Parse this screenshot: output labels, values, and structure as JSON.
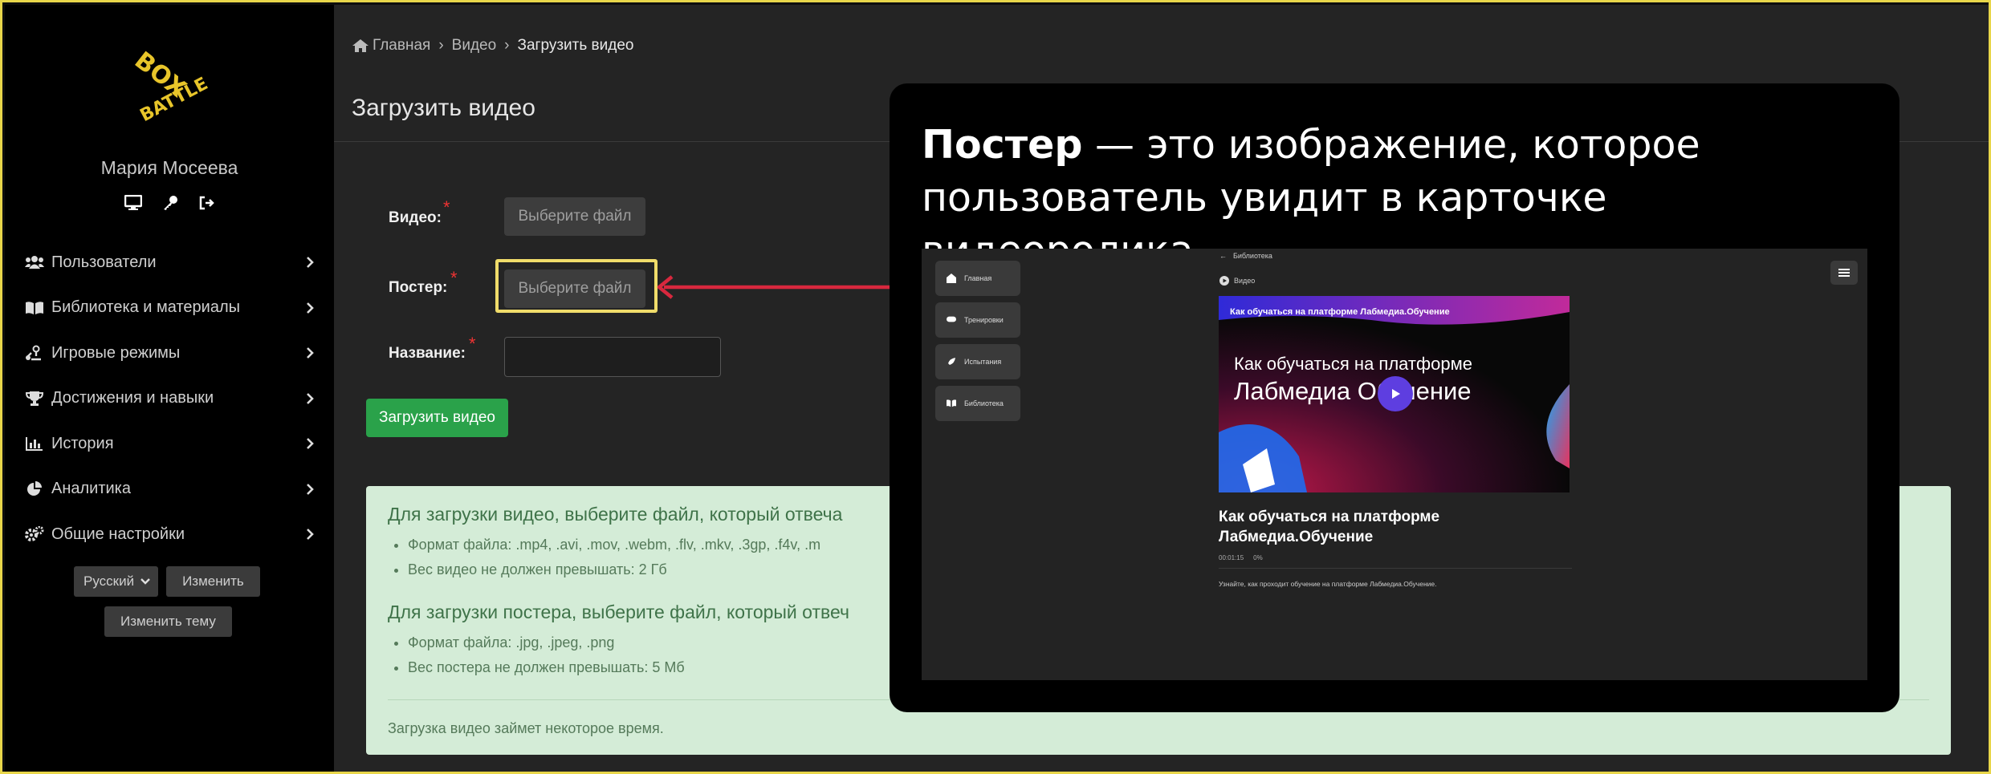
{
  "sidebar": {
    "logo_text": "BOX BATTLE",
    "user_name": "Мария Мосеева",
    "menu": [
      {
        "label": "Пользователи",
        "icon": "users-icon"
      },
      {
        "label": "Библиотека и материалы",
        "icon": "book-icon"
      },
      {
        "label": "Игровые режимы",
        "icon": "game-mode-icon"
      },
      {
        "label": "Достижения и навыки",
        "icon": "trophy-icon"
      },
      {
        "label": "История",
        "icon": "bar-chart-icon"
      },
      {
        "label": "Аналитика",
        "icon": "pie-chart-icon"
      },
      {
        "label": "Общие настройки",
        "icon": "gears-icon"
      }
    ],
    "language": "Русский",
    "change_label": "Изменить",
    "change_theme_label": "Изменить тему"
  },
  "breadcrumb": {
    "home": "Главная",
    "video": "Видео",
    "current": "Загрузить видео"
  },
  "page_title": "Загрузить видео",
  "form": {
    "video_label": "Видео:",
    "poster_label": "Постер:",
    "name_label": "Название:",
    "file_button": "Выберите файл",
    "name_value": "",
    "submit_label": "Загрузить видео"
  },
  "info": {
    "video_heading": "Для загрузки видео, выберите файл, который отвеча",
    "video_items": [
      "Формат файла: .mp4, .avi, .mov, .webm, .flv, .mkv, .3gp, .f4v, .m",
      "Вес видео не должен превышать: 2 Гб"
    ],
    "poster_heading": "Для загрузки постера, выберите файл, который отвеч",
    "poster_items": [
      "Формат файла: .jpg, .jpeg, .png",
      "Вес постера не должен превышать: 5 Мб"
    ],
    "note": "Загрузка видео займет некоторое время."
  },
  "callout": {
    "bold": "Постер",
    "rest": " — это изображение, которое пользователь увидит в карточке видеоролика."
  },
  "preview": {
    "nav": [
      "Главная",
      "Тренировки",
      "Испытания",
      "Библиотека"
    ],
    "back_label": "Библиотека",
    "section_label": "Видео",
    "thumb_top": "Как обучаться на платформе Лабмедиа.Обучение",
    "thumb_line1": "Как обучаться на платформе",
    "thumb_line2": "Лабмедиа  Обучение",
    "title": "Как обучаться на платформе Лабмедиа.Обучение",
    "duration": "00:01:15",
    "progress": "0%",
    "description": "Узнайте, как проходит обучение на платформе Лабмедиа.Обучение."
  },
  "colors": {
    "accent_yellow": "#f0dc6a",
    "arrow_red": "#d8283e",
    "submit_green": "#2aa24a",
    "info_bg": "#d4ecd7"
  }
}
